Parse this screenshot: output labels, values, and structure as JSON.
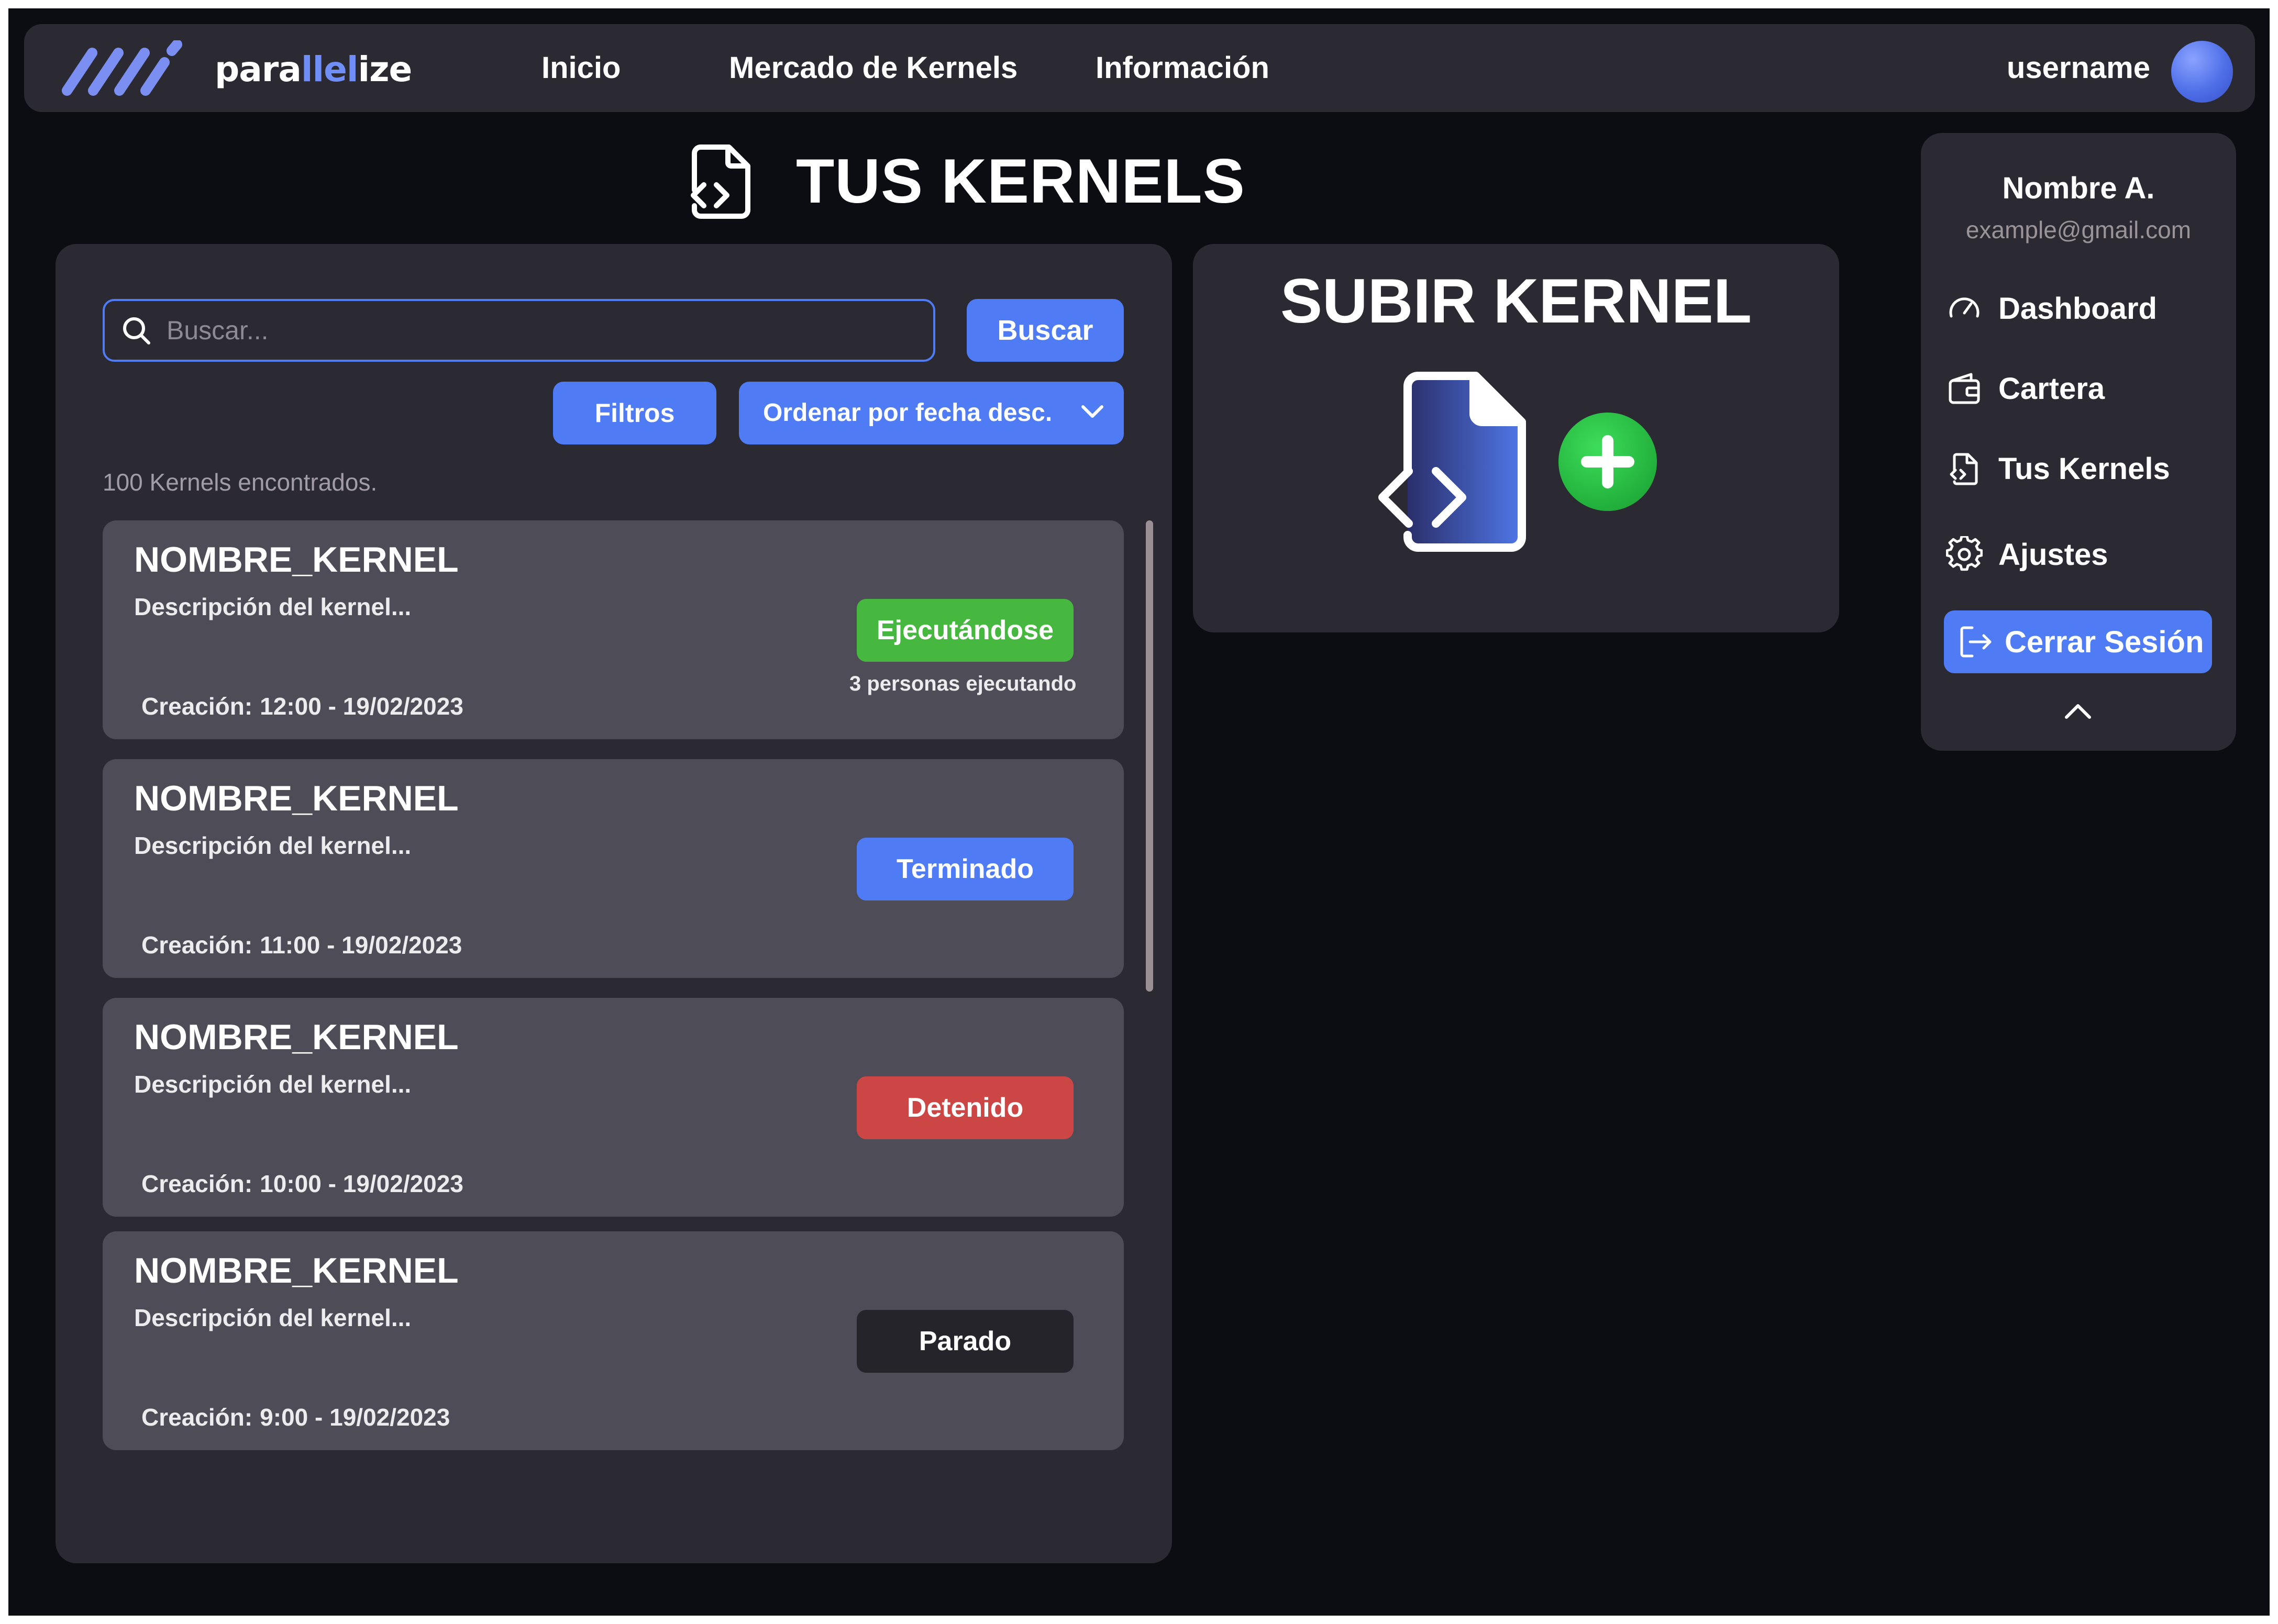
{
  "brand": {
    "name_prefix": "para",
    "name_highlight": "llel",
    "name_suffix": "ize"
  },
  "nav": {
    "links": [
      "Inicio",
      "Mercado de Kernels",
      "Información"
    ],
    "username": "username"
  },
  "page": {
    "title": "TUS KERNELS"
  },
  "list": {
    "search_placeholder": "Buscar...",
    "search_button": "Buscar",
    "filter_button": "Filtros",
    "sort_selected": "Ordenar por fecha desc.",
    "results_count": "100 Kernels encontrados.",
    "creation_label": "Creación:",
    "kernels": [
      {
        "name": "NOMBRE_KERNEL",
        "description": "Descripción del kernel...",
        "created": "12:00 - 19/02/2023",
        "status": "Ejecutándose",
        "status_color": "#46b83f",
        "runners": "3 personas ejecutando"
      },
      {
        "name": "NOMBRE_KERNEL",
        "description": "Descripción del kernel...",
        "created": "11:00 - 19/02/2023",
        "status": "Terminado",
        "status_color": "#4f7cf5",
        "runners": ""
      },
      {
        "name": "NOMBRE_KERNEL",
        "description": "Descripción del kernel...",
        "created": "10:00 - 19/02/2023",
        "status": "Detenido",
        "status_color": "#cc4646",
        "runners": ""
      },
      {
        "name": "NOMBRE_KERNEL",
        "description": "Descripción del kernel...",
        "created": "9:00 - 19/02/2023",
        "status": "Parado",
        "status_color": "#25242b",
        "runners": ""
      }
    ]
  },
  "upload": {
    "title": "SUBIR KERNEL",
    "icon": "file-code-icon",
    "badge_icon": "plus-icon"
  },
  "user_menu": {
    "name": "Nombre A.",
    "email": "example@gmail.com",
    "items": [
      {
        "label": "Dashboard",
        "icon": "gauge-icon"
      },
      {
        "label": "Cartera",
        "icon": "wallet-icon"
      },
      {
        "label": "Tus Kernels",
        "icon": "file-code-icon"
      },
      {
        "label": "Ajustes",
        "icon": "gear-icon"
      }
    ],
    "logout": "Cerrar Sesión"
  },
  "colors": {
    "accent": "#4f7cf5",
    "background": "#0c0d12",
    "panel": "#2b2a33",
    "card": "#4d4c57",
    "success": "#46b83f",
    "danger": "#cc4646"
  }
}
